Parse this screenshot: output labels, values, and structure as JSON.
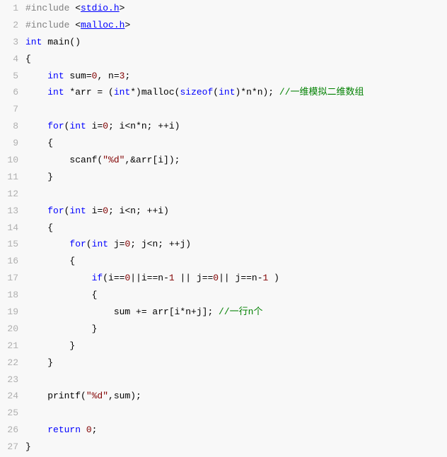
{
  "lines": [
    {
      "n": "1",
      "segments": [
        {
          "cls": "pp",
          "t": "#include"
        },
        {
          "cls": "",
          "t": " "
        },
        {
          "cls": "angle",
          "t": "<"
        },
        {
          "cls": "linked",
          "t": "stdio.h"
        },
        {
          "cls": "angle",
          "t": ">"
        }
      ]
    },
    {
      "n": "2",
      "segments": [
        {
          "cls": "pp",
          "t": "#include"
        },
        {
          "cls": "",
          "t": " "
        },
        {
          "cls": "angle",
          "t": "<"
        },
        {
          "cls": "linked",
          "t": "malloc.h"
        },
        {
          "cls": "angle",
          "t": ">"
        }
      ]
    },
    {
      "n": "3",
      "segments": [
        {
          "cls": "kw",
          "t": "int"
        },
        {
          "cls": "",
          "t": " main()"
        }
      ]
    },
    {
      "n": "4",
      "segments": [
        {
          "cls": "",
          "t": "{"
        }
      ]
    },
    {
      "n": "5",
      "segments": [
        {
          "cls": "",
          "t": "    "
        },
        {
          "cls": "kw",
          "t": "int"
        },
        {
          "cls": "",
          "t": " sum="
        },
        {
          "cls": "num",
          "t": "0"
        },
        {
          "cls": "",
          "t": ", n="
        },
        {
          "cls": "num",
          "t": "3"
        },
        {
          "cls": "",
          "t": ";"
        }
      ]
    },
    {
      "n": "6",
      "segments": [
        {
          "cls": "",
          "t": "    "
        },
        {
          "cls": "kw",
          "t": "int"
        },
        {
          "cls": "",
          "t": " *arr = ("
        },
        {
          "cls": "kw",
          "t": "int"
        },
        {
          "cls": "",
          "t": "*)malloc("
        },
        {
          "cls": "kw",
          "t": "sizeof"
        },
        {
          "cls": "",
          "t": "("
        },
        {
          "cls": "kw",
          "t": "int"
        },
        {
          "cls": "",
          "t": ")*n*n); "
        },
        {
          "cls": "cmt",
          "t": "//一维模拟二维数组"
        }
      ]
    },
    {
      "n": "7",
      "segments": []
    },
    {
      "n": "8",
      "segments": [
        {
          "cls": "",
          "t": "    "
        },
        {
          "cls": "kw",
          "t": "for"
        },
        {
          "cls": "",
          "t": "("
        },
        {
          "cls": "kw",
          "t": "int"
        },
        {
          "cls": "",
          "t": " i="
        },
        {
          "cls": "num",
          "t": "0"
        },
        {
          "cls": "",
          "t": "; i<n*n; ++i)"
        }
      ]
    },
    {
      "n": "9",
      "segments": [
        {
          "cls": "",
          "t": "    {"
        }
      ]
    },
    {
      "n": "10",
      "segments": [
        {
          "cls": "",
          "t": "        scanf("
        },
        {
          "cls": "str",
          "t": "\"%d\""
        },
        {
          "cls": "",
          "t": ",&arr[i]);"
        }
      ]
    },
    {
      "n": "11",
      "segments": [
        {
          "cls": "",
          "t": "    }"
        }
      ]
    },
    {
      "n": "12",
      "segments": []
    },
    {
      "n": "13",
      "segments": [
        {
          "cls": "",
          "t": "    "
        },
        {
          "cls": "kw",
          "t": "for"
        },
        {
          "cls": "",
          "t": "("
        },
        {
          "cls": "kw",
          "t": "int"
        },
        {
          "cls": "",
          "t": " i="
        },
        {
          "cls": "num",
          "t": "0"
        },
        {
          "cls": "",
          "t": "; i<n; ++i)"
        }
      ]
    },
    {
      "n": "14",
      "segments": [
        {
          "cls": "",
          "t": "    {"
        }
      ]
    },
    {
      "n": "15",
      "segments": [
        {
          "cls": "",
          "t": "        "
        },
        {
          "cls": "kw",
          "t": "for"
        },
        {
          "cls": "",
          "t": "("
        },
        {
          "cls": "kw",
          "t": "int"
        },
        {
          "cls": "",
          "t": " j="
        },
        {
          "cls": "num",
          "t": "0"
        },
        {
          "cls": "",
          "t": "; j<n; ++j)"
        }
      ]
    },
    {
      "n": "16",
      "segments": [
        {
          "cls": "",
          "t": "        {"
        }
      ]
    },
    {
      "n": "17",
      "segments": [
        {
          "cls": "",
          "t": "            "
        },
        {
          "cls": "kw",
          "t": "if"
        },
        {
          "cls": "",
          "t": "(i=="
        },
        {
          "cls": "num",
          "t": "0"
        },
        {
          "cls": "",
          "t": "||i==n-"
        },
        {
          "cls": "num",
          "t": "1"
        },
        {
          "cls": "",
          "t": " || j=="
        },
        {
          "cls": "num",
          "t": "0"
        },
        {
          "cls": "",
          "t": "|| j==n-"
        },
        {
          "cls": "num",
          "t": "1"
        },
        {
          "cls": "",
          "t": " )"
        }
      ]
    },
    {
      "n": "18",
      "segments": [
        {
          "cls": "",
          "t": "            {"
        }
      ]
    },
    {
      "n": "19",
      "segments": [
        {
          "cls": "",
          "t": "                sum += arr[i*n+j]; "
        },
        {
          "cls": "cmt",
          "t": "//一行n个"
        }
      ]
    },
    {
      "n": "20",
      "segments": [
        {
          "cls": "",
          "t": "            }"
        }
      ]
    },
    {
      "n": "21",
      "segments": [
        {
          "cls": "",
          "t": "        }"
        }
      ]
    },
    {
      "n": "22",
      "segments": [
        {
          "cls": "",
          "t": "    }"
        }
      ]
    },
    {
      "n": "23",
      "segments": []
    },
    {
      "n": "24",
      "segments": [
        {
          "cls": "",
          "t": "    printf("
        },
        {
          "cls": "str",
          "t": "\"%d\""
        },
        {
          "cls": "",
          "t": ",sum);"
        }
      ]
    },
    {
      "n": "25",
      "segments": []
    },
    {
      "n": "26",
      "segments": [
        {
          "cls": "",
          "t": "    "
        },
        {
          "cls": "kw",
          "t": "return"
        },
        {
          "cls": "",
          "t": " "
        },
        {
          "cls": "num",
          "t": "0"
        },
        {
          "cls": "",
          "t": ";"
        }
      ]
    },
    {
      "n": "27",
      "segments": [
        {
          "cls": "",
          "t": "}"
        }
      ]
    }
  ]
}
